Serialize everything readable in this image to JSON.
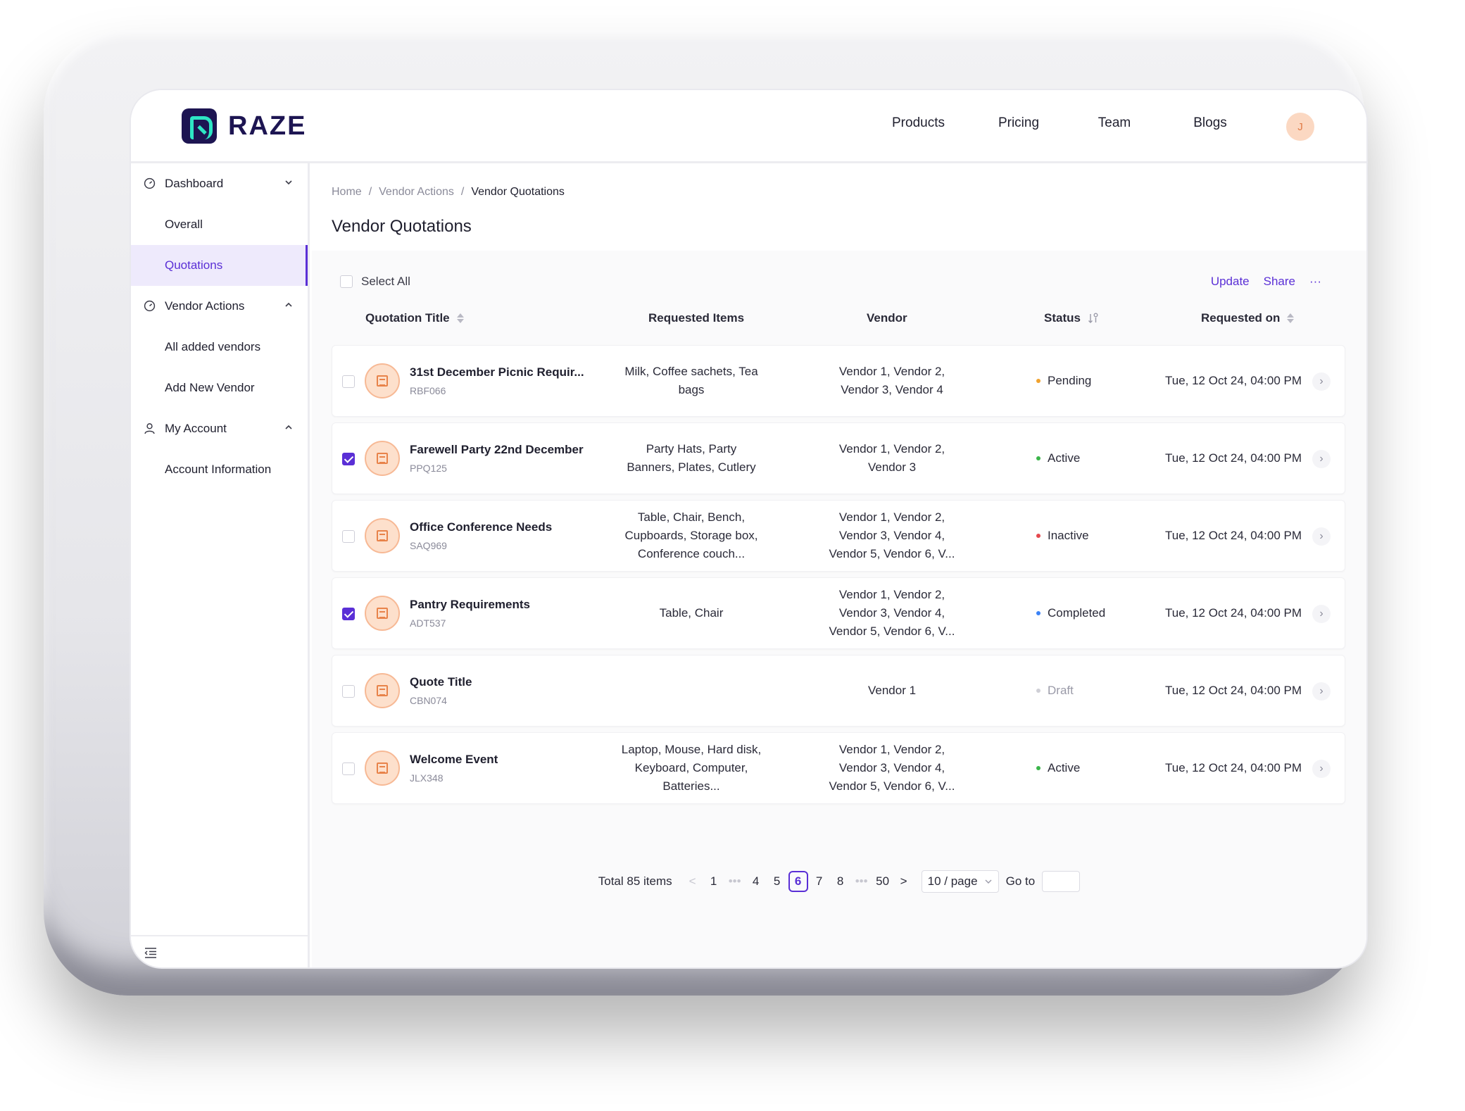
{
  "brand": {
    "name": "RAZE"
  },
  "nav": {
    "items": [
      "Products",
      "Pricing",
      "Team",
      "Blogs"
    ]
  },
  "user": {
    "avatar_initial": "J"
  },
  "sidebar": {
    "dashboard": {
      "label": "Dashboard",
      "children": [
        "Overall",
        "Quotations"
      ]
    },
    "vendor_actions": {
      "label": "Vendor Actions",
      "children": [
        "All added vendors",
        "Add New Vendor"
      ]
    },
    "my_account": {
      "label": "My Account",
      "children": [
        "Account Information"
      ]
    },
    "active_item": "Quotations"
  },
  "breadcrumb": [
    "Home",
    "Vendor Actions",
    "Vendor Quotations"
  ],
  "page": {
    "title": "Vendor Quotations"
  },
  "toolbar": {
    "select_all": "Select All",
    "update": "Update",
    "share": "Share",
    "more": "···"
  },
  "table": {
    "headers": {
      "title": "Quotation Title",
      "items": "Requested Items",
      "vendor": "Vendor",
      "status": "Status",
      "date": "Requested on"
    },
    "rows": [
      {
        "checked": false,
        "title": "31st December Picnic Requir...",
        "code": "RBF066",
        "items": "Milk, Coffee sachets, Tea bags",
        "vendor": "Vendor 1, Vendor 2, Vendor 3, Vendor 4",
        "status": "Pending",
        "date": "Tue, 12 Oct 24, 04:00 PM"
      },
      {
        "checked": true,
        "title": "Farewell Party 22nd December",
        "code": "PPQ125",
        "items": "Party Hats, Party Banners, Plates, Cutlery",
        "vendor": "Vendor 1, Vendor 2, Vendor 3",
        "status": "Active",
        "date": "Tue, 12 Oct 24, 04:00 PM"
      },
      {
        "checked": false,
        "title": "Office Conference Needs",
        "code": "SAQ969",
        "items": "Table, Chair, Bench, Cupboards, Storage box, Conference couch...",
        "vendor": "Vendor 1, Vendor 2, Vendor 3, Vendor 4, Vendor 5, Vendor 6, V...",
        "status": "Inactive",
        "date": "Tue, 12 Oct 24, 04:00 PM"
      },
      {
        "checked": true,
        "title": "Pantry Requirements",
        "code": "ADT537",
        "items": "Table, Chair",
        "vendor": "Vendor 1, Vendor 2, Vendor 3, Vendor 4, Vendor 5, Vendor 6, V...",
        "status": "Completed",
        "date": "Tue, 12 Oct 24, 04:00 PM"
      },
      {
        "checked": false,
        "title": "Quote Title",
        "code": "CBN074",
        "items": "",
        "vendor": "Vendor 1",
        "status": "Draft",
        "date": "Tue, 12 Oct 24, 04:00 PM"
      },
      {
        "checked": false,
        "title": "Welcome Event",
        "code": "JLX348",
        "items": "Laptop, Mouse, Hard disk, Keyboard, Computer, Batteries...",
        "vendor": "Vendor 1, Vendor 2, Vendor 3, Vendor 4, Vendor 5, Vendor 6, V...",
        "status": "Active",
        "date": "Tue, 12 Oct 24, 04:00 PM"
      }
    ]
  },
  "status_colors": {
    "Pending": "#f0a22e",
    "Active": "#3bb54a",
    "Inactive": "#e5484d",
    "Completed": "#3b82f6",
    "Draft": "#cfcfd6"
  },
  "pagination": {
    "total": "Total 85 items",
    "pages": [
      "1",
      "•••",
      "4",
      "5",
      "6",
      "7",
      "8",
      "•••",
      "50"
    ],
    "current": "6",
    "page_size": "10 / page",
    "goto_label": "Go to"
  },
  "icons": [
    "dashboard-icon",
    "vendor-actions-icon",
    "user-icon",
    "chevron-down-icon",
    "chevron-up-icon",
    "collapse-menu-icon",
    "sort-icon",
    "filter-sort-icon",
    "document-icon",
    "chevron-right-icon"
  ]
}
